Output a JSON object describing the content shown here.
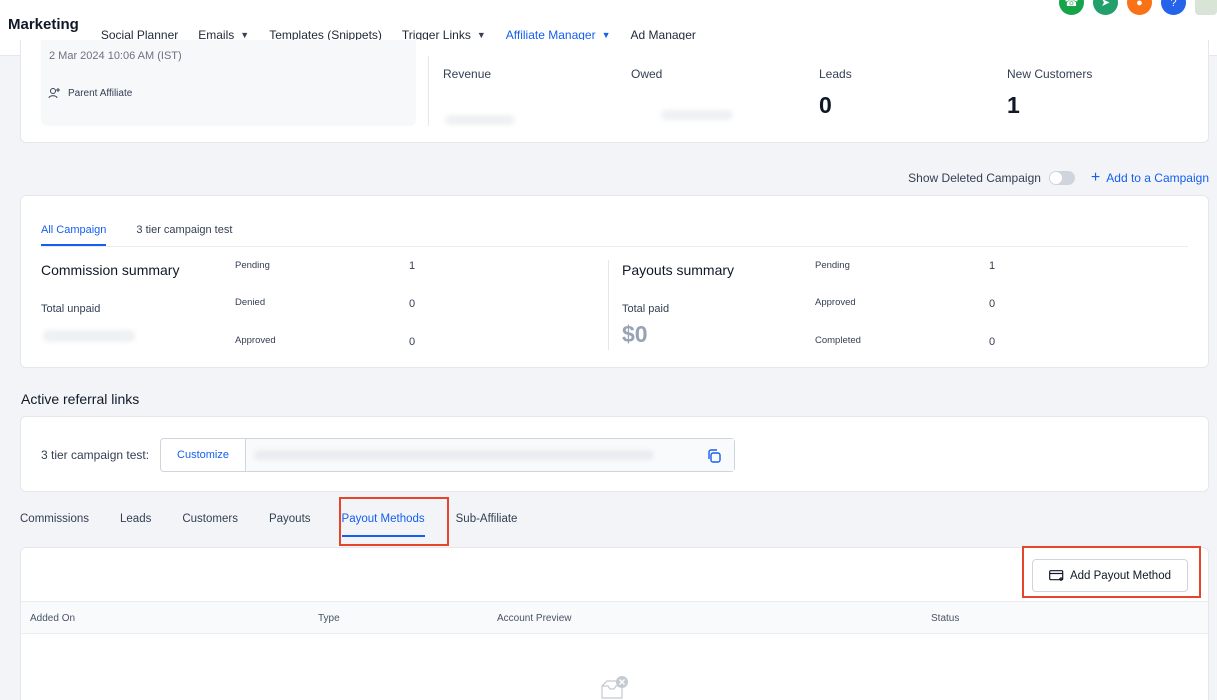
{
  "nav": {
    "brand": "Marketing",
    "items": [
      {
        "label": "Social Planner",
        "dropdown": false,
        "active": false
      },
      {
        "label": "Emails",
        "dropdown": true,
        "active": false
      },
      {
        "label": "Templates (Snippets)",
        "dropdown": false,
        "active": false
      },
      {
        "label": "Trigger Links",
        "dropdown": true,
        "active": false
      },
      {
        "label": "Affiliate Manager",
        "dropdown": true,
        "active": true
      },
      {
        "label": "Ad Manager",
        "dropdown": false,
        "active": false
      }
    ],
    "icons": [
      {
        "name": "phone-icon",
        "color": "#16a34a"
      },
      {
        "name": "megaphone-icon",
        "color": "#22a06b"
      },
      {
        "name": "bell-icon",
        "color": "#f97316"
      },
      {
        "name": "help-icon",
        "color": "#2563eb"
      }
    ]
  },
  "affiliate": {
    "date": "2 Mar 2024 10:06 AM (IST)",
    "parent_label": "Parent Affiliate",
    "stats": [
      {
        "label": "Revenue",
        "value": ""
      },
      {
        "label": "Owed",
        "value": ""
      },
      {
        "label": "Leads",
        "value": "0"
      },
      {
        "label": "New Customers",
        "value": "1"
      }
    ]
  },
  "campaign_actions": {
    "show_deleted_label": "Show Deleted Campaign",
    "show_deleted_on": false,
    "add_campaign_label": "Add to a Campaign"
  },
  "campaign": {
    "tabs": [
      "All Campaign",
      "3 tier campaign test"
    ],
    "active_tab": 0,
    "commission": {
      "title": "Commission summary",
      "total_label": "Total unpaid",
      "rows": [
        {
          "label": "Pending",
          "value": "1"
        },
        {
          "label": "Denied",
          "value": "0"
        },
        {
          "label": "Approved",
          "value": "0"
        }
      ]
    },
    "payouts": {
      "title": "Payouts summary",
      "total_label": "Total paid",
      "total_value": "$0",
      "rows": [
        {
          "label": "Pending",
          "value": "1"
        },
        {
          "label": "Approved",
          "value": "0"
        },
        {
          "label": "Completed",
          "value": "0"
        }
      ]
    }
  },
  "referral": {
    "section_title": "Active referral links",
    "link_label": "3 tier campaign test:",
    "customize_label": "Customize"
  },
  "lower_tabs": {
    "items": [
      "Commissions",
      "Leads",
      "Customers",
      "Payouts",
      "Payout Methods",
      "Sub-Affiliate"
    ],
    "active": 4
  },
  "payout_table": {
    "add_button": "Add Payout Method",
    "columns": [
      "Added On",
      "Type",
      "Account Preview",
      "Status"
    ]
  },
  "colors": {
    "accent": "#155eef",
    "highlight": "#e5452a"
  }
}
